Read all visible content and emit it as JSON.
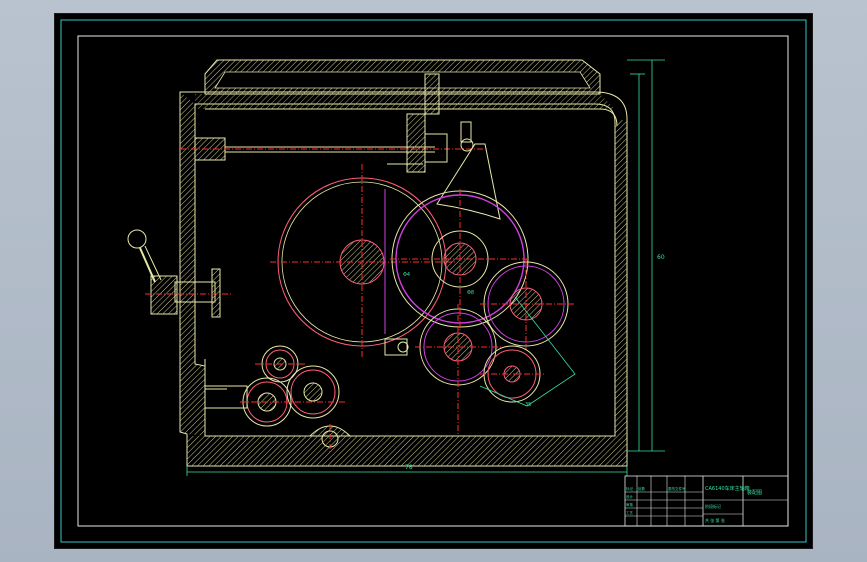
{
  "sheet": {
    "background": "#000000",
    "frame_color": "#34c6c6",
    "line_color": "#e8e8a8",
    "hatch_color": "#c8c890",
    "center_color": "#ff2a2a",
    "gear_color": "#ff5c7a",
    "magenta": "#d040e0",
    "dim_color": "#36e0a0"
  },
  "labels": {
    "dim_right": "60",
    "dim_bottom": "78",
    "dim_gear_a": "Φ4",
    "dim_gear_b": "Φ8",
    "dim_sector": "35",
    "dim_center": "—"
  },
  "title_block": {
    "name_cell": "CA6140车床主轴箱",
    "drawing_no": "装配图",
    "rows": [
      [
        "标记",
        "处数",
        "分区",
        "更改文件号",
        "签名",
        "年月日"
      ],
      [
        "设计",
        "",
        "",
        "标准化",
        "",
        ""
      ],
      [
        "审核",
        "",
        "",
        "",
        "",
        ""
      ],
      [
        "工艺",
        "",
        "",
        "批准",
        "",
        ""
      ]
    ],
    "stage": "阶段标记",
    "weight": "重量",
    "scale": "比例",
    "sheet_count": "共 张 第 张"
  }
}
